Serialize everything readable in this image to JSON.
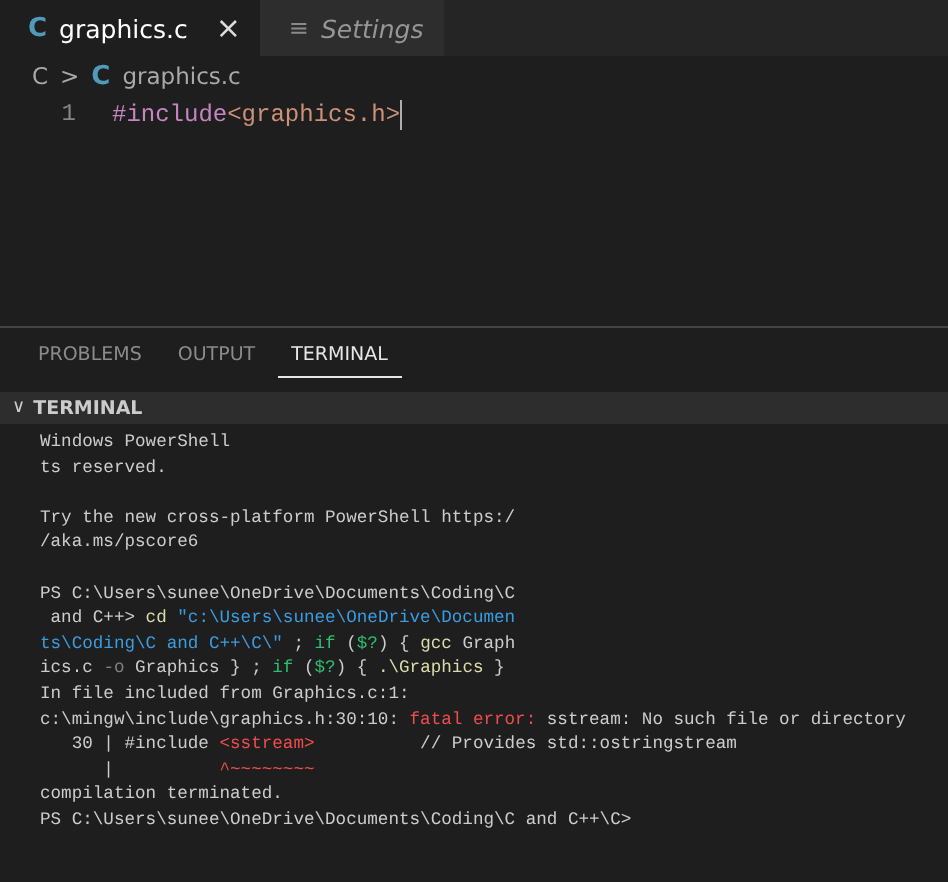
{
  "editor_tabs": [
    {
      "icon": "C",
      "label": "graphics.c",
      "selected": true,
      "close": "×",
      "italic": false
    },
    {
      "icon": "≡",
      "label": "Settings",
      "selected": false,
      "italic": true
    }
  ],
  "breadcrumb": {
    "folder": "C",
    "separator": ">",
    "file_icon": "C",
    "file": "graphics.c"
  },
  "code_lines": [
    {
      "number": "1",
      "tokens": [
        {
          "kind": "directive",
          "text": "#include"
        },
        {
          "kind": "header",
          "text": "<graphics.h>"
        }
      ]
    }
  ],
  "panel_tabs": [
    {
      "label": "PROBLEMS",
      "selected": false
    },
    {
      "label": "OUTPUT",
      "selected": false
    },
    {
      "label": "TERMINAL",
      "selected": true
    }
  ],
  "terminal": {
    "header": {
      "chevron": "∨",
      "title": "TERMINAL",
      "expanded": true
    },
    "lines": [
      {
        "kind": "text",
        "segments": [
          {
            "kind": "plain",
            "text": "Windows PowerShell"
          }
        ]
      },
      {
        "kind": "text",
        "segments": [
          {
            "kind": "plain",
            "text": "ts reserved."
          }
        ]
      },
      {
        "kind": "blank"
      },
      {
        "kind": "text",
        "segments": [
          {
            "kind": "plain",
            "text": "Try the new cross-platform PowerShell https:/"
          }
        ]
      },
      {
        "kind": "text",
        "segments": [
          {
            "kind": "plain",
            "text": "/aka.ms/pscore6"
          }
        ]
      },
      {
        "kind": "blank"
      },
      {
        "kind": "text",
        "segments": [
          {
            "kind": "plain",
            "text": "PS C:\\Users\\sunee\\OneDrive\\Documents\\Coding\\C"
          }
        ]
      },
      {
        "kind": "text",
        "segments": [
          {
            "kind": "plain",
            "text": " and C++> "
          },
          {
            "kind": "command",
            "text": "cd"
          },
          {
            "kind": "string",
            "text": " \"c:\\Users\\sunee\\OneDrive\\Documen"
          }
        ]
      },
      {
        "kind": "text",
        "segments": [
          {
            "kind": "string",
            "text": "ts\\Coding\\C and C++\\C\\\""
          },
          {
            "kind": "plain",
            "text": " ; "
          },
          {
            "kind": "keyword",
            "text": "if"
          },
          {
            "kind": "plain",
            "text": " ("
          },
          {
            "kind": "keyword",
            "text": "$?"
          },
          {
            "kind": "plain",
            "text": ") { "
          },
          {
            "kind": "command",
            "text": "gcc"
          },
          {
            "kind": "plain",
            "text": " Graph"
          }
        ]
      },
      {
        "kind": "text",
        "segments": [
          {
            "kind": "plain",
            "text": "ics.c "
          },
          {
            "kind": "param",
            "text": "-o"
          },
          {
            "kind": "plain",
            "text": " Graphics } ; "
          },
          {
            "kind": "keyword",
            "text": "if"
          },
          {
            "kind": "plain",
            "text": " ("
          },
          {
            "kind": "keyword",
            "text": "$?"
          },
          {
            "kind": "plain",
            "text": ") { "
          },
          {
            "kind": "command",
            "text": ".\\Graphics"
          },
          {
            "kind": "plain",
            "text": " }"
          }
        ]
      },
      {
        "kind": "text",
        "segments": [
          {
            "kind": "plain",
            "text": "In file included from Graphics.c:1:"
          }
        ]
      },
      {
        "kind": "text",
        "segments": [
          {
            "kind": "plain",
            "text": "c:\\mingw\\include\\graphics.h:30:10: "
          },
          {
            "kind": "error",
            "text": "fatal error:"
          },
          {
            "kind": "plain",
            "text": " sstream: No such file or directory"
          }
        ]
      },
      {
        "kind": "text",
        "segments": [
          {
            "kind": "plain",
            "text": "   30 | #include "
          },
          {
            "kind": "error",
            "text": "<sstream>"
          },
          {
            "kind": "plain",
            "text": "          // Provides std::ostringstream"
          }
        ]
      },
      {
        "kind": "text",
        "segments": [
          {
            "kind": "plain",
            "text": "      |"
          },
          {
            "kind": "error",
            "text": "          ^~~~~~~~~"
          }
        ]
      },
      {
        "kind": "text",
        "segments": [
          {
            "kind": "plain",
            "text": "compilation terminated."
          }
        ]
      },
      {
        "kind": "text",
        "segments": [
          {
            "kind": "plain",
            "text": "PS C:\\Users\\sunee\\OneDrive\\Documents\\Coding\\C and C++\\C>"
          }
        ]
      }
    ]
  }
}
